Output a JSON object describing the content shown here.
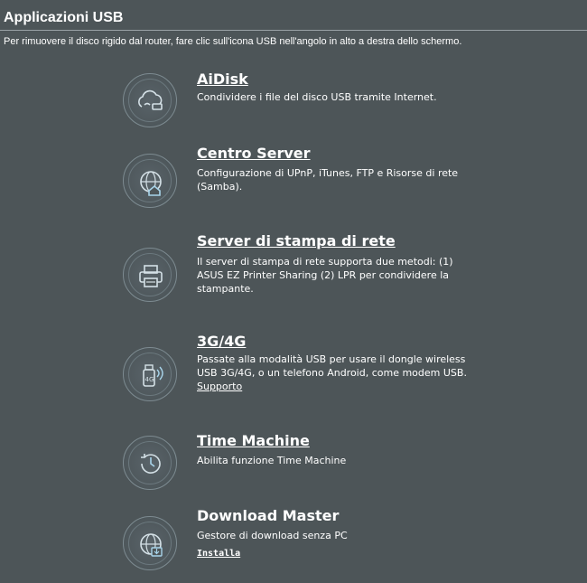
{
  "header": {
    "title": "Applicazioni USB",
    "subtitle": "Per rimuovere il disco rigido dal router, fare clic sull'icona USB nell'angolo in alto a destra dello schermo."
  },
  "apps": [
    {
      "title": "AiDisk",
      "description": "Condividere i file del disco USB tramite Internet.",
      "icon": "cloud-usb-icon"
    },
    {
      "title": "Centro Server",
      "description": "Configurazione di UPnP, iTunes, FTP e Risorse di rete (Samba).",
      "icon": "globe-house-icon"
    },
    {
      "title": "Server di stampa di rete",
      "description": "Il server di stampa di rete supporta due metodi: (1) ASUS EZ Printer Sharing (2) LPR per condividere la stampante.",
      "icon": "printer-icon"
    },
    {
      "title": "3G/4G",
      "description": "Passate alla modalità USB per usare il dongle wireless USB 3G/4G, o un telefono Android, come modem USB.",
      "link_label": "Supporto",
      "icon": "usb-dongle-icon"
    },
    {
      "title": "Time Machine",
      "description": "Abilita funzione Time Machine",
      "icon": "clock-icon"
    },
    {
      "title": "Download Master",
      "description": "Gestore di download senza PC",
      "install_label": "Installa",
      "icon": "globe-download-icon"
    }
  ],
  "colors": {
    "background": "#4d5558",
    "icon_stroke": "#d4e0e6",
    "icon_accent": "#a8d4ea"
  }
}
